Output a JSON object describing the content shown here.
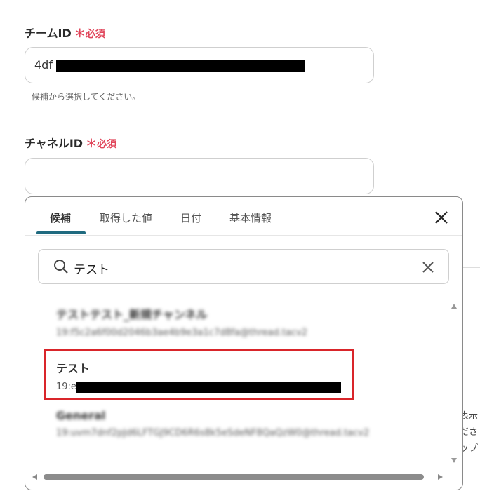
{
  "team_field": {
    "label": "チームID",
    "required_mark": "＊",
    "required_text": "必須",
    "value_prefix": "4df",
    "help": "候補から選択してください。"
  },
  "channel_field": {
    "label": "チャネルID",
    "required_mark": "＊",
    "required_text": "必須",
    "value": ""
  },
  "background_fragments": [
    "表示",
    "ださ",
    "ップ"
  ],
  "popup": {
    "tabs": [
      {
        "label": "候補",
        "active": true
      },
      {
        "label": "取得した値",
        "active": false
      },
      {
        "label": "日付",
        "active": false
      },
      {
        "label": "基本情報",
        "active": false
      }
    ],
    "search": {
      "value": "テスト",
      "icon": "search-icon",
      "clear_icon": "close-icon"
    },
    "close_icon": "close-icon",
    "results": [
      {
        "title": "テストテスト_新規チャンネル",
        "subtitle": "19:f5c2a6f00d2046b3ae4b9e3a1c7d8fa@thread.tacv2",
        "blurred": true
      },
      {
        "title": "テスト",
        "subtitle_prefix": "19:e",
        "blurred": false,
        "highlighted": true
      },
      {
        "title": "General",
        "subtitle": "19:uvm7dnf2pJd6LFTGJ9CD6R6s8k5eSdeNF8QaQzW0@thread.tacv2",
        "blurred": true
      }
    ],
    "highlight_color": "#d9252a",
    "tab_indicator_color": "#1f6a7f"
  }
}
